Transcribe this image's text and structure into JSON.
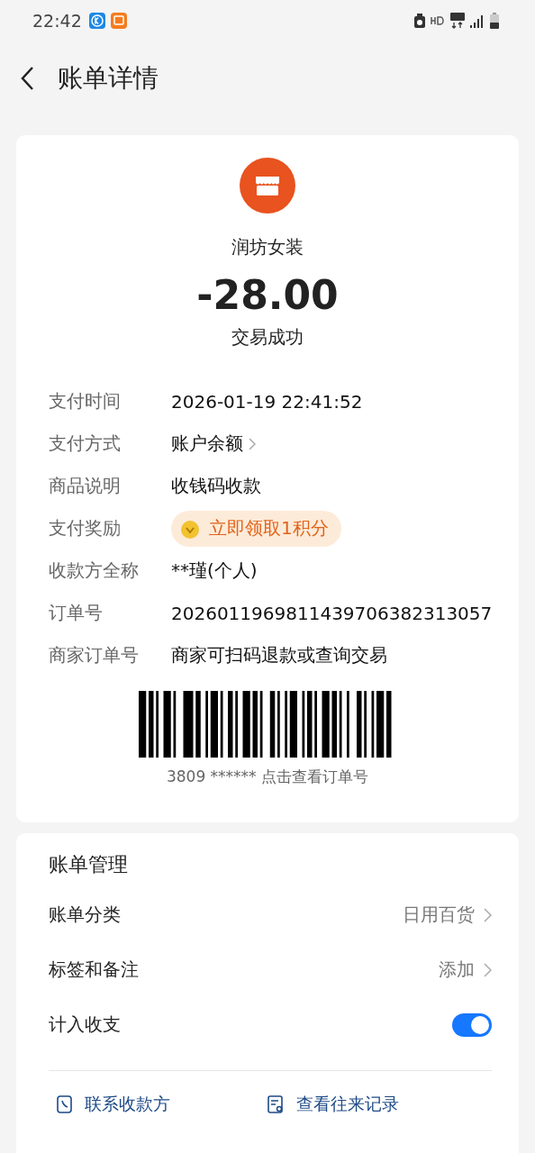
{
  "status_bar": {
    "time": "22:42"
  },
  "header": {
    "title": "账单详情"
  },
  "summary": {
    "merchant": "润坊女装",
    "amount": "-28.00",
    "status": "交易成功"
  },
  "details": [
    {
      "kind": "text",
      "label": "支付时间",
      "value": "2026-01-19 22:41:52"
    },
    {
      "kind": "link",
      "label": "支付方式",
      "value": "账户余额"
    },
    {
      "kind": "text",
      "label": "商品说明",
      "value": "收钱码收款"
    },
    {
      "kind": "reward",
      "label": "支付奖励",
      "value": "立即领取1积分"
    },
    {
      "kind": "text",
      "label": "收款方全称",
      "value": "**瑾(个人)"
    },
    {
      "kind": "text",
      "label": "订单号",
      "value": "2026011969811439706382313057"
    },
    {
      "kind": "text",
      "label": "商家订单号",
      "value": "商家可扫码退款或查询交易"
    }
  ],
  "barcode": {
    "caption": "3809 ****** 点击查看订单号"
  },
  "management": {
    "title": "账单管理",
    "rows": [
      {
        "kind": "link",
        "label": "账单分类",
        "value": "日用百货"
      },
      {
        "kind": "link",
        "label": "标签和备注",
        "value": "添加"
      },
      {
        "kind": "toggle",
        "label": "计入收支",
        "on": true
      }
    ]
  },
  "actions": [
    "联系收款方",
    "查看往来记录"
  ]
}
